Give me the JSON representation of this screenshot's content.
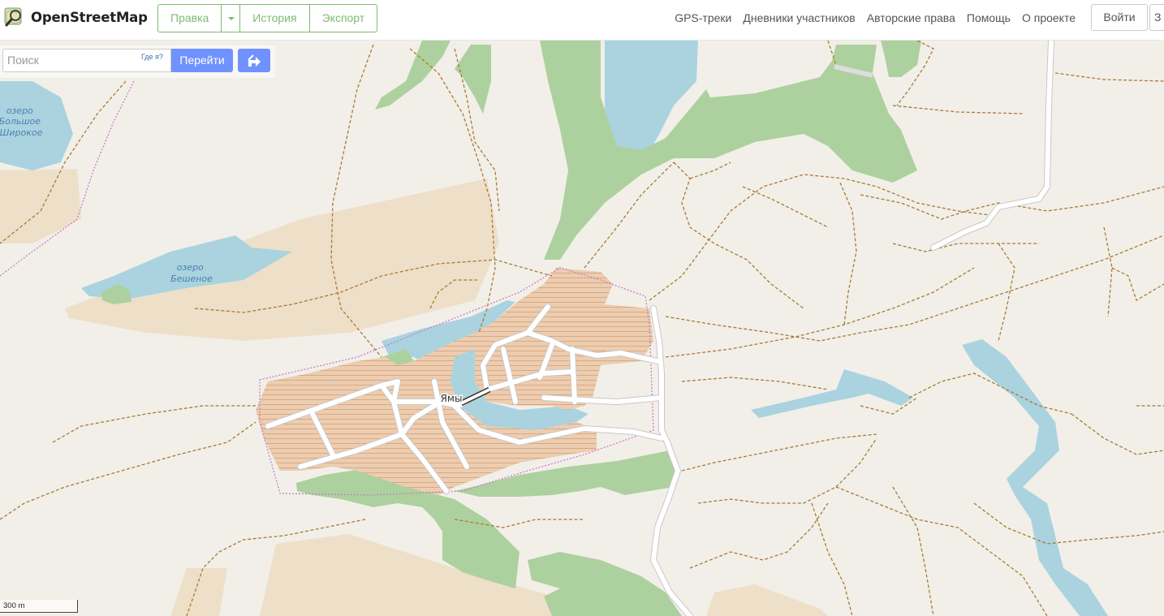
{
  "header": {
    "logo_text": "OpenStreetMap",
    "edit_label": "Правка",
    "history_label": "История",
    "export_label": "Экспорт",
    "nav": [
      "GPS-треки",
      "Дневники участников",
      "Авторские права",
      "Помощь",
      "О проекте"
    ],
    "login_label": "Войти",
    "signup_label": "З"
  },
  "search": {
    "placeholder": "Поиск",
    "where_label": "Где я?",
    "go_label": "Перейти"
  },
  "map": {
    "labels": {
      "lake1": [
        "озеро",
        "Большое",
        "Широкое"
      ],
      "lake2": [
        "озеро",
        "Бешеное"
      ],
      "village": "Ямы"
    },
    "scale_label": "300 m"
  },
  "colors": {
    "accent": "#7ebc6f",
    "button": "#7092ff",
    "water": "#aad3df",
    "forest": "#add19e",
    "farmland": "#eedfc9",
    "residential": "#e0c0a0",
    "track": "#a87b2e",
    "boundary": "#c77dc7"
  }
}
